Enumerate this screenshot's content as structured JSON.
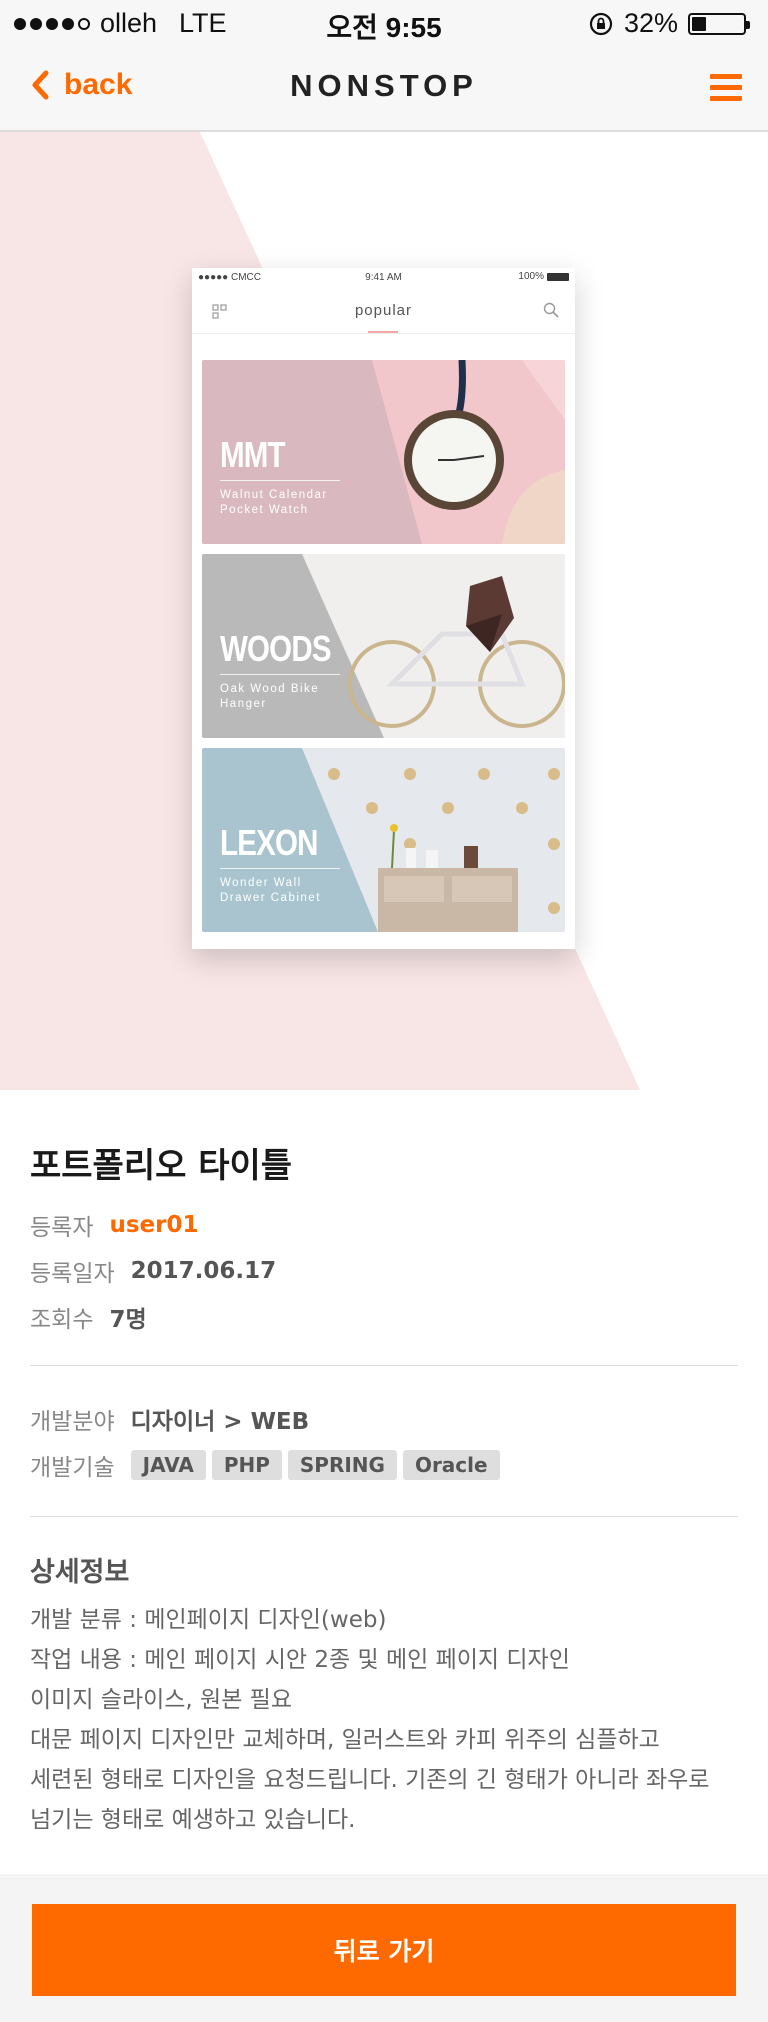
{
  "status_bar": {
    "carrier": "olleh",
    "network": "LTE",
    "time": "오전 9:55",
    "battery": "32%"
  },
  "navbar": {
    "back_label": "back",
    "title": "NONSTOP"
  },
  "mockup": {
    "status": {
      "carrier": "●●●●● CMCC",
      "time": "9:41 AM",
      "battery": "100%"
    },
    "header_title": "popular",
    "cards": [
      {
        "name": "MMT",
        "subtitle_line1": "Walnut Calendar",
        "subtitle_line2": "Pocket Watch",
        "color": "#d9b9bf"
      },
      {
        "name": "WOODS",
        "subtitle_line1": "Oak Wood Bike",
        "subtitle_line2": "Hanger",
        "color": "#b9b9b9"
      },
      {
        "name": "LEXON",
        "subtitle_line1": "Wonder Wall",
        "subtitle_line2": "Drawer Cabinet",
        "color": "#a9c4cf"
      }
    ]
  },
  "portfolio": {
    "title": "포트폴리오 타이틀",
    "registrant_label": "등록자",
    "registrant": "user01",
    "date_label": "등록일자",
    "date": "2017.06.17",
    "views_label": "조회수",
    "views": "7명",
    "field_label": "개발분야",
    "field": "디자이너 > WEB",
    "tech_label": "개발기술",
    "tech_tags": [
      "JAVA",
      "PHP",
      "SPRING",
      "Oracle"
    ],
    "detail_title": "상세정보",
    "detail_lines": [
      "개발 분류 :  메인페이지 디자인(web)",
      "작업 내용 : 메인 페이지 시안 2종 및 메인 페이지 디자인",
      "이미지 슬라이스, 원본 필요",
      "대문 페이지 디자인만 교체하며, 일러스트와 카피 위주의 심플하고",
      "세련된 형태로 디자인을 요청드립니다. 기존의 긴 형태가 아니라 좌우로",
      "넘기는 형태로 예생하고 있습니다."
    ]
  },
  "footer": {
    "back_button": "뒤로 가기"
  },
  "colors": {
    "accent": "#ff6a00",
    "hero_pink": "#f8e5e6"
  }
}
